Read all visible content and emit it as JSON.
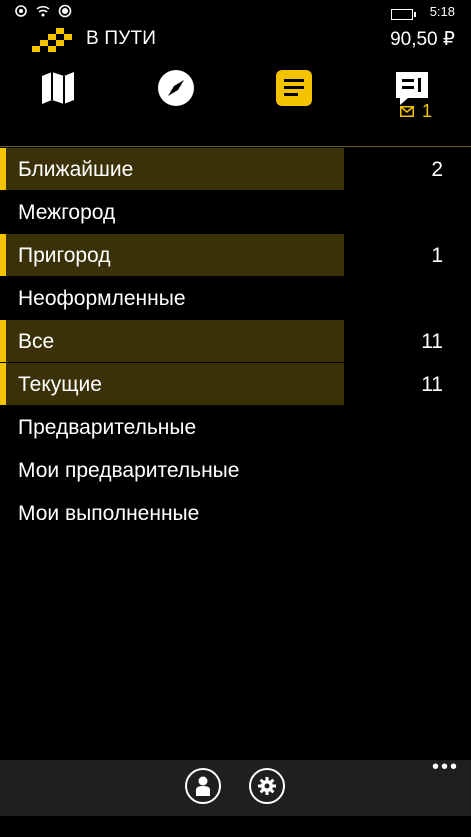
{
  "status_bar": {
    "time": "5:18",
    "icons": [
      "signal-icon",
      "wifi-icon",
      "location-icon",
      "battery-icon"
    ]
  },
  "header": {
    "status": "В ПУТИ",
    "balance": "90,50 ₽"
  },
  "toolbar": {
    "buttons": [
      "map-icon",
      "compass-icon",
      "orders-icon",
      "messages-icon"
    ],
    "active": "orders-icon",
    "messages_count": "1"
  },
  "list": {
    "items": [
      {
        "label": "Ближайшие",
        "count": "2",
        "highlighted": true
      },
      {
        "label": "Межгород",
        "count": "",
        "highlighted": false
      },
      {
        "label": "Пригород",
        "count": "1",
        "highlighted": true
      },
      {
        "label": "Неоформленные",
        "count": "",
        "highlighted": false
      },
      {
        "label": "Все",
        "count": "11",
        "highlighted": true
      },
      {
        "label": "Текущие",
        "count": "11",
        "highlighted": true
      },
      {
        "label": "Предварительные",
        "count": "",
        "highlighted": false
      },
      {
        "label": "Мои предварительные",
        "count": "",
        "highlighted": false
      },
      {
        "label": "Мои выполненные",
        "count": "",
        "highlighted": false
      }
    ]
  },
  "appbar": {
    "buttons": [
      "profile-icon",
      "settings-icon"
    ],
    "more": "•••"
  },
  "colors": {
    "accent": "#f5c400",
    "highlight_bg": "#3a3108",
    "background": "#000000",
    "appbar_bg": "#1f1f1f"
  }
}
